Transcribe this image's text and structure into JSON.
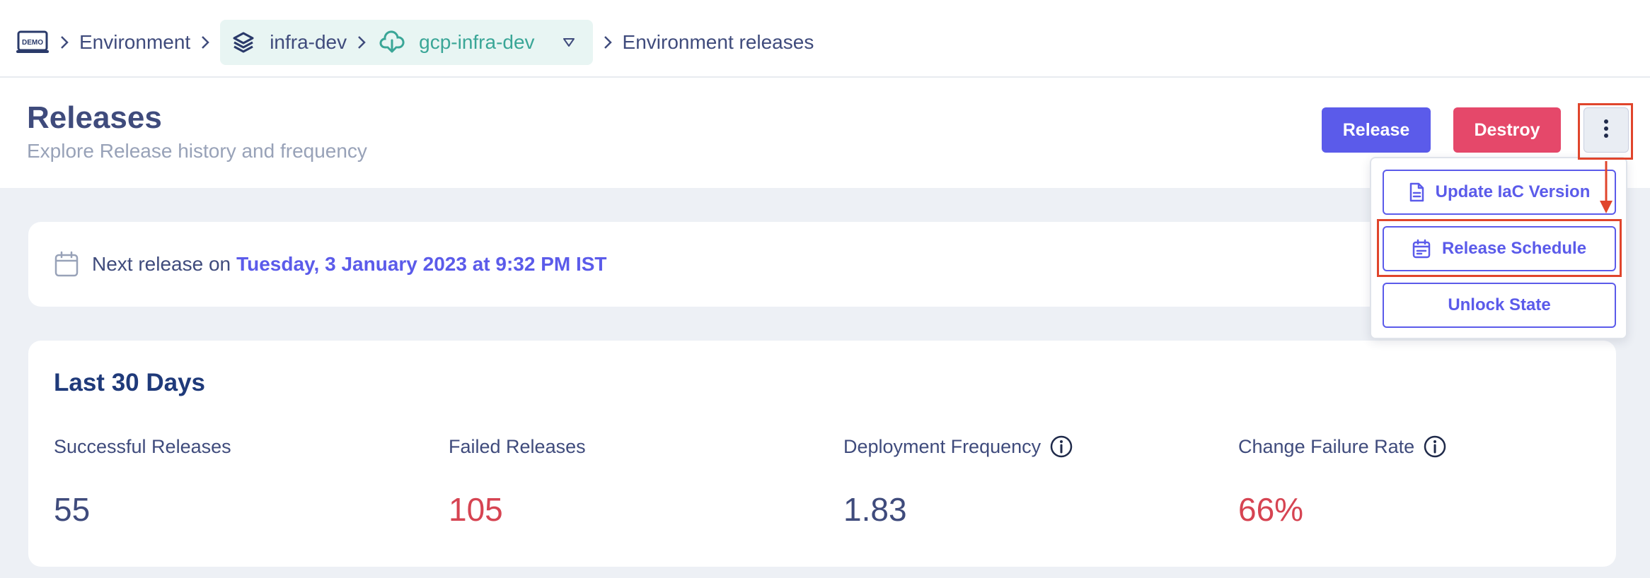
{
  "breadcrumb": {
    "logo_text": "DEMO",
    "items": [
      "Environment",
      "infra-dev",
      "gcp-infra-dev",
      "Environment releases"
    ]
  },
  "header": {
    "title": "Releases",
    "subtitle": "Explore Release history and frequency",
    "release_label": "Release",
    "destroy_label": "Destroy"
  },
  "menu": {
    "items": [
      "Update IaC Version",
      "Release Schedule",
      "Unlock State"
    ]
  },
  "next_release": {
    "label": "Next release on",
    "date": "Tuesday, 3 January 2023 at 9:32 PM IST"
  },
  "stats": {
    "title": "Last 30 Days",
    "items": [
      {
        "label": "Successful Releases",
        "value": "55"
      },
      {
        "label": "Failed Releases",
        "value": "105"
      },
      {
        "label": "Deployment Frequency",
        "value": "1.83"
      },
      {
        "label": "Change Failure Rate",
        "value": "66%"
      }
    ]
  },
  "colors": {
    "accent": "#5b5bea",
    "danger": "#e5486a",
    "teal": "#3aa697",
    "annotation": "#e0452c"
  }
}
